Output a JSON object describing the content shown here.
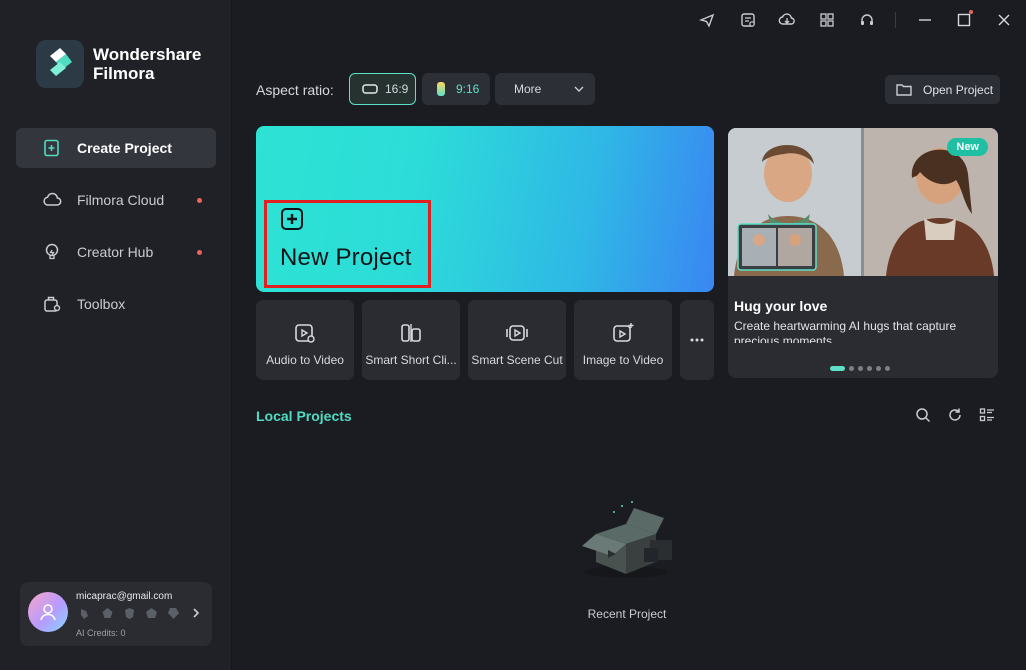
{
  "app": {
    "brand_line1": "Wondershare",
    "brand_line2": "Filmora"
  },
  "sidebar": {
    "items": [
      {
        "label": "Create Project",
        "icon": "create-project-icon",
        "active": true
      },
      {
        "label": "Filmora Cloud",
        "icon": "cloud-icon",
        "dot": true
      },
      {
        "label": "Creator Hub",
        "icon": "lightbulb-icon",
        "dot": true
      },
      {
        "label": "Toolbox",
        "icon": "toolbox-icon"
      }
    ],
    "user": {
      "email": "micaprac@gmail.com",
      "credits": "AI Credits: 0"
    }
  },
  "toolbar": {
    "aspect_label": "Aspect ratio:",
    "ratio_16_9": "16:9",
    "ratio_9_16": "9:16",
    "more": "More",
    "open_project": "Open Project"
  },
  "new_project": {
    "label": "New Project"
  },
  "tools": [
    {
      "label": "Audio to Video",
      "icon": "audio-to-video-icon"
    },
    {
      "label": "Smart Short Cli...",
      "icon": "smart-short-clips-icon"
    },
    {
      "label": "Smart Scene Cut",
      "icon": "scene-cut-icon"
    },
    {
      "label": "Image to Video",
      "icon": "image-to-video-icon"
    }
  ],
  "promo": {
    "badge": "New",
    "title": "Hug your love",
    "description": "Create heartwarming AI hugs that capture precious moments."
  },
  "local_projects": {
    "title": "Local Projects",
    "empty_label": "Recent Project"
  },
  "colors": {
    "accent": "#4fdcc2",
    "highlight": "#e02020",
    "notify_dot": "#f0645a"
  }
}
